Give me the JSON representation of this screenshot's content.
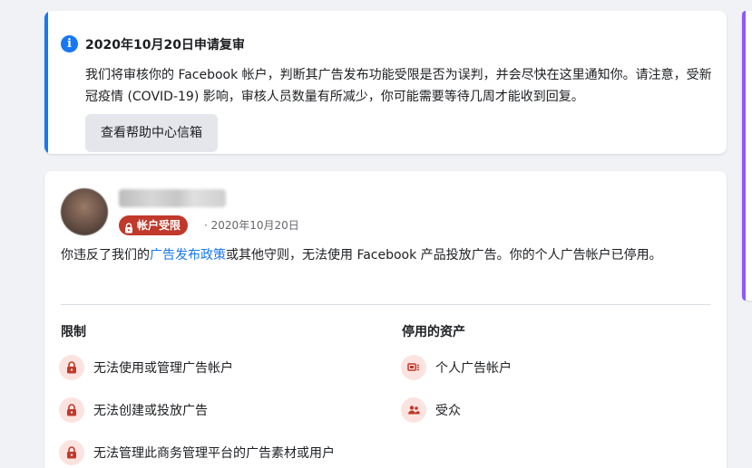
{
  "notice": {
    "title": "2020年10月20日申请复审",
    "body": "我们将审核你的 Facebook 帐户，判断其广告发布功能受限是否为误判，并会尽快在这里通知你。请注意，受新冠疫情 (COVID-19) 影响，审核人员数量有所减少，你可能需要等待几周才能收到回复。",
    "help_button": "查看帮助中心信箱",
    "info_icon": "info-icon"
  },
  "account": {
    "badge_label": "帐户受限",
    "date": "2020年10月20日",
    "separator": "·"
  },
  "violation": {
    "prefix": "你违反了我们的",
    "link": "广告发布政策",
    "suffix": "或其他守则，无法使用 Facebook 产品投放广告。你的个人广告帐户已停用。"
  },
  "restrictions": {
    "title": "限制",
    "items": [
      {
        "label": "无法使用或管理广告帐户",
        "icon": "lock-icon"
      },
      {
        "label": "无法创建或投放广告",
        "icon": "lock-icon"
      },
      {
        "label": "无法管理此商务管理平台的广告素材或用户",
        "icon": "lock-icon"
      }
    ]
  },
  "disabled_assets": {
    "title": "停用的资产",
    "items": [
      {
        "label": "个人广告帐户",
        "icon": "ad-account-icon"
      },
      {
        "label": "受众",
        "icon": "audience-icon"
      }
    ]
  },
  "colors": {
    "accent": "#1877f2",
    "restricted": "#c0392b",
    "icon_bg": "#fbe3e0",
    "side_accent": "#8b5cf6"
  }
}
